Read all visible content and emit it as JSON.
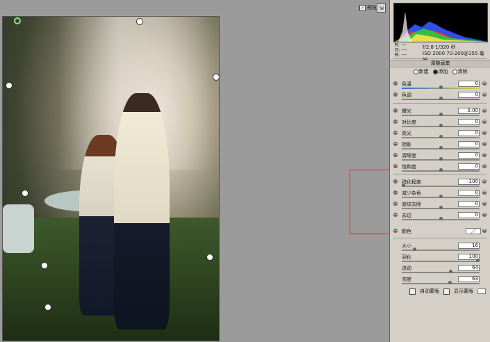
{
  "topbar": {
    "preview_label": "预览",
    "preview_checked": "✓",
    "fullscreen_icon": "⇲"
  },
  "panel": {
    "readout": {
      "r": "R: ---",
      "g": "G: ---",
      "b": "B: ---",
      "exposure": "f/2.8   1/320 秒",
      "iso": "ISO 2000   70-200@155 毫米"
    },
    "title": "调整画笔",
    "modes": [
      {
        "label": "新建",
        "selected": false
      },
      {
        "label": "添加",
        "selected": true
      },
      {
        "label": "清除",
        "selected": false
      }
    ],
    "group1": [
      {
        "label": "色温",
        "value": "0",
        "pos": 0.5
      },
      {
        "label": "色调",
        "value": "0",
        "pos": 0.5
      }
    ],
    "group2": [
      {
        "label": "曝光",
        "value": "0.00",
        "pos": 0.5
      },
      {
        "label": "对比度",
        "value": "0",
        "pos": 0.5
      },
      {
        "label": "高光",
        "value": "0",
        "pos": 0.5
      },
      {
        "label": "阴影",
        "value": "0",
        "pos": 0.5
      },
      {
        "label": "清晰度",
        "value": "0",
        "pos": 0.5
      },
      {
        "label": "饱和度",
        "value": "0",
        "pos": 0.5
      }
    ],
    "group3": [
      {
        "label": "锐化程度",
        "value": "-100",
        "pos": 0.0
      },
      {
        "label": "减少杂色",
        "value": "0",
        "pos": 0.5
      },
      {
        "label": "波纹去除",
        "value": "0",
        "pos": 0.5
      },
      {
        "label": "去边",
        "value": "0",
        "pos": 0.5
      }
    ],
    "color_label": "颜色",
    "brush": [
      {
        "label": "大小",
        "value": "16",
        "pos": 0.15
      },
      {
        "label": "羽化",
        "value": "100",
        "pos": 1.0
      },
      {
        "label": "流动",
        "value": "64",
        "pos": 0.64
      },
      {
        "label": "浓度",
        "value": "63",
        "pos": 0.63
      }
    ],
    "auto_mask_label": "自动蒙版",
    "show_mask_label": "显示蒙版"
  }
}
